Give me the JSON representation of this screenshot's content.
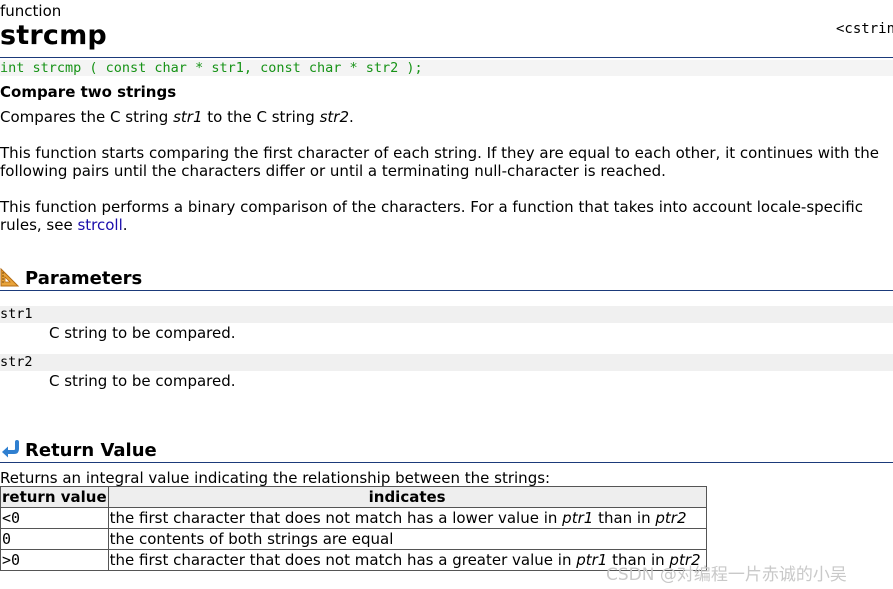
{
  "page": {
    "kind": "function",
    "title": "strcmp",
    "header_lib": "<cstring>",
    "prototype": "int strcmp ( const char * str1, const char * str2 );",
    "subtitle": "Compare two strings",
    "para1": [
      "Compares the C string ",
      "str1",
      " to the C string ",
      "str2",
      "."
    ],
    "para2": "This function starts comparing the first character of each string. If they are equal to each other, it continues with the following pairs until the characters differ or until a terminating null-character is reached.",
    "para3": {
      "text": "This function performs a binary comparison of the characters. For a function that takes into account locale-specific rules, see ",
      "link": "strcoll",
      "end": "."
    }
  },
  "parameters": {
    "title": "Parameters",
    "icon": "ruler-triangle-icon",
    "items": [
      {
        "name": "str1",
        "desc": "C string to be compared."
      },
      {
        "name": "str2",
        "desc": "C string to be compared."
      }
    ]
  },
  "return_value": {
    "title": "Return Value",
    "icon": "return-arrow-icon",
    "intro": "Returns an integral value indicating the relationship between the strings:",
    "table": {
      "headers": [
        "return value",
        "indicates"
      ],
      "rows": [
        {
          "value": "<0",
          "text": [
            "the first character that does not match has a lower value in ",
            "ptr1",
            " than in ",
            "ptr2"
          ]
        },
        {
          "value": "0",
          "text": [
            "the contents of both strings are equal"
          ]
        },
        {
          "value": ">0",
          "text": [
            "the first character that does not match has a greater value in ",
            "ptr1",
            " than in ",
            "ptr2"
          ]
        }
      ]
    }
  },
  "watermark": "CSDN @对编程一片赤诚的小吴",
  "colors": {
    "rule": "#1b3a7a",
    "prototype_text": "#179317",
    "link": "#1a0dab",
    "code_bg": "#f4f4f4"
  }
}
